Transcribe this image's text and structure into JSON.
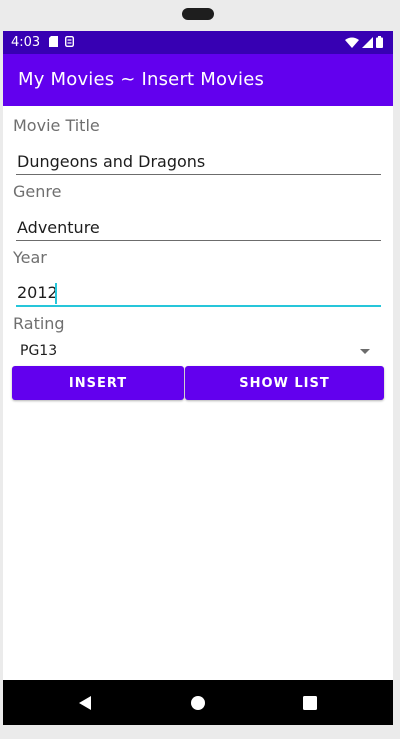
{
  "status_bar": {
    "time": "4:03",
    "icons_left": [
      "sd-card-icon",
      "sim-icon"
    ],
    "icons_right": [
      "wifi-icon",
      "signal-icon",
      "battery-icon"
    ]
  },
  "app_bar": {
    "title": "My Movies ~ Insert Movies"
  },
  "form": {
    "movie_title": {
      "label": "Movie Title",
      "value": "Dungeons and Dragons"
    },
    "genre": {
      "label": "Genre",
      "value": "Adventure"
    },
    "year": {
      "label": "Year",
      "value": "2012"
    },
    "rating": {
      "label": "Rating",
      "selected": "PG13"
    }
  },
  "buttons": {
    "insert": "INSERT",
    "show_list": "SHOW LIST"
  },
  "nav_bar": {
    "icons": [
      "back-icon",
      "home-icon",
      "recents-icon"
    ]
  },
  "colors": {
    "status_bar": "#3700b3",
    "primary": "#6200ee",
    "accent": "#26c6da"
  }
}
